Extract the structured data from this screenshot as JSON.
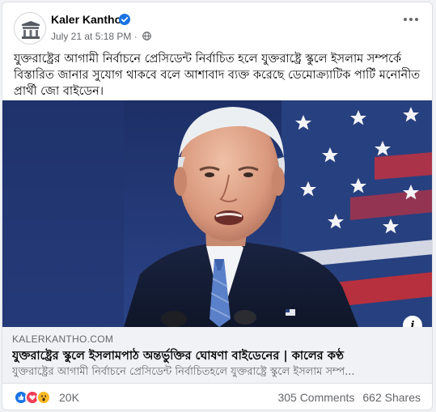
{
  "post": {
    "page_name": "Kaler Kantho",
    "timestamp": "July 21 at 5:18 PM",
    "separator": " · ",
    "text": "যুক্তরাষ্ট্রের আগামী নির্বাচনে প্রেসিডেন্ট নির্বাচিত হলে যুক্তরাষ্ট্রে স্কুলে ইসলাম সম্পর্কে বিস্তারিত জানার সুযোগ থাকবে বলে আশাবাদ ব্যক্ত করেছে ডেমোক্র্যাটিক পার্টি মনোনীত প্রার্থী জো বাইডেন।"
  },
  "link": {
    "domain": "KALERKANTHO.COM",
    "title": "যুক্তরাষ্ট্রের স্কুলে ইসলামপাঠ অন্তর্ভুক্তির ঘোষণা বাইডেনের | কালের কণ্ঠ",
    "description": "যুক্তরাষ্ট্রের আগামী নির্বাচনে প্রেসিডেন্ট নির্বাচিতহলে যুক্তরাষ্ট্রে স্কুলে ইসলাম সম্প..."
  },
  "image": {
    "info_label": "i"
  },
  "engagement": {
    "reaction_count": "20K",
    "comments": "305 Comments",
    "shares": "662 Shares",
    "reactions": [
      "like",
      "love",
      "wow"
    ]
  },
  "icons": {
    "verified": "verified-badge-icon",
    "globe": "globe-icon",
    "more": "more-options-icon"
  },
  "colors": {
    "verified_blue": "#1b74e4",
    "link_bg": "#f0f2f5",
    "secondary_text": "#65676b"
  }
}
